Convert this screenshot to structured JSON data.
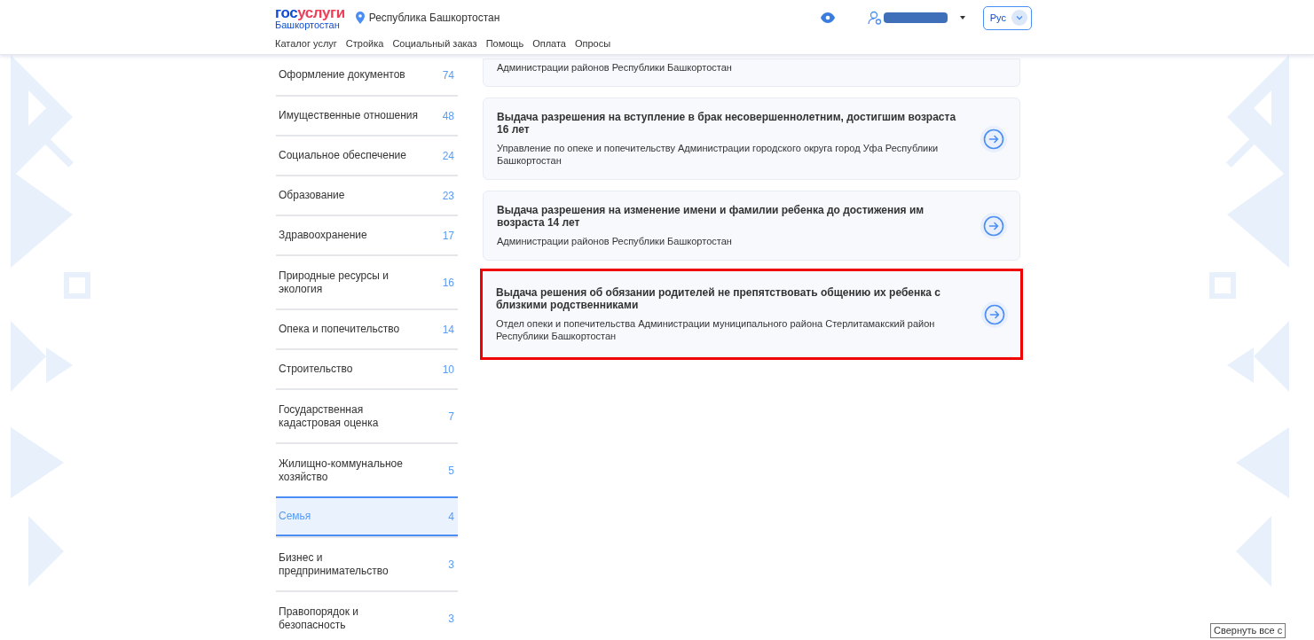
{
  "header": {
    "logo_top_left": "гос",
    "logo_top_right": "услуги",
    "logo_bottom": "Башкортостан",
    "region": "Республика Башкортостан",
    "nav": [
      "Каталог услуг",
      "Стройка",
      "Социальный заказ",
      "Помощь",
      "Оплата",
      "Опросы"
    ],
    "language": "Рус"
  },
  "sidebar": {
    "items": [
      {
        "label": "Оформление документов",
        "count": "74",
        "selected": false
      },
      {
        "label": "Имущественные отношения",
        "count": "48",
        "selected": false
      },
      {
        "label": "Социальное обеспечение",
        "count": "24",
        "selected": false
      },
      {
        "label": "Образование",
        "count": "23",
        "selected": false
      },
      {
        "label": "Здравоохранение",
        "count": "17",
        "selected": false
      },
      {
        "label": "Природные ресурсы и экология",
        "count": "16",
        "selected": false
      },
      {
        "label": "Опека и попечительство",
        "count": "14",
        "selected": false
      },
      {
        "label": "Строительство",
        "count": "10",
        "selected": false
      },
      {
        "label": "Государственная кадастровая оценка",
        "count": "7",
        "selected": false
      },
      {
        "label": "Жилищно-коммунальное хозяйство",
        "count": "5",
        "selected": false
      },
      {
        "label": "Семья",
        "count": "4",
        "selected": true
      },
      {
        "label": "Бизнес и предпринимательство",
        "count": "3",
        "selected": false
      },
      {
        "label": "Правопорядок и безопасность",
        "count": "3",
        "selected": false
      }
    ]
  },
  "services": [
    {
      "description": "Администрации районов Республики Башкортостан",
      "highlighted": false
    },
    {
      "title": "Выдача разрешения на вступление в брак несовершеннолетним, достигшим возраста 16 лет",
      "description": "Управление по опеке и попечительству Администрации городского округа город Уфа Республики Башкортостан",
      "highlighted": false
    },
    {
      "title": "Выдача разрешения на изменение имени и фамилии ребенка до достижения им возраста 14 лет",
      "description": "Администрации районов Республики Башкортостан",
      "highlighted": false
    },
    {
      "title": "Выдача решения об обязании родителей не препятствовать общению их ребенка с близкими родственниками",
      "description": "Отдел опеки и попечительства Администрации муниципального района Стерлитамакский район Республики Башкортостан",
      "highlighted": true
    }
  ],
  "tooltip": "Свернуть все с"
}
